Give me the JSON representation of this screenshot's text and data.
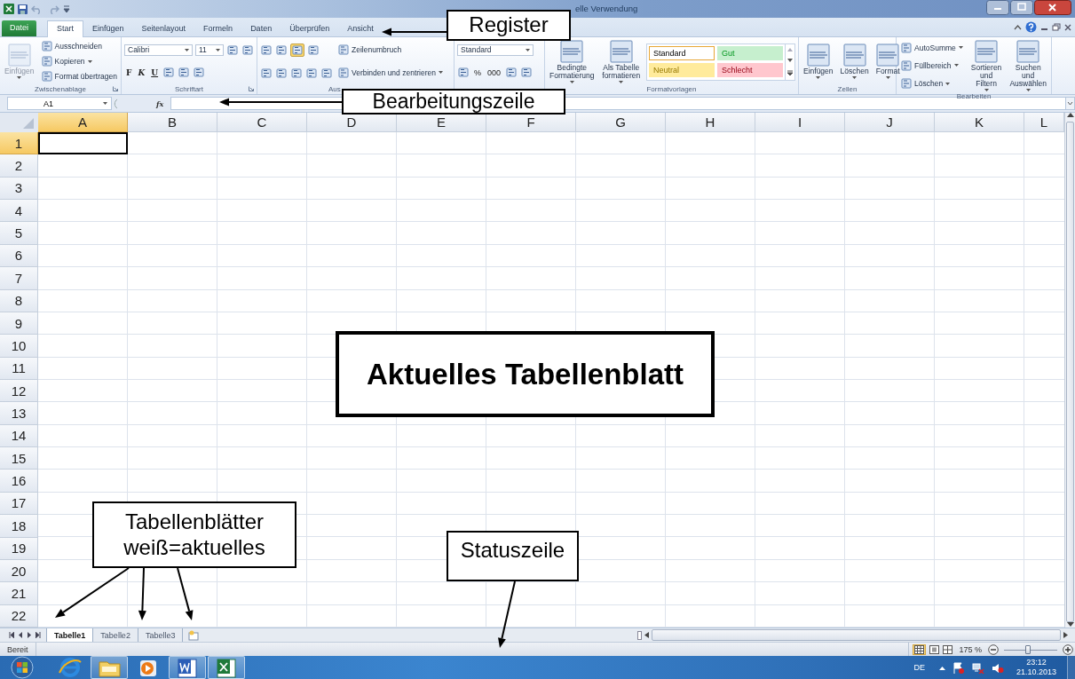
{
  "window": {
    "title": "elle Verwendung"
  },
  "tabs": [
    {
      "label": "Datei",
      "kind": "file",
      "selected": false
    },
    {
      "label": "Start",
      "kind": "tab",
      "selected": true
    },
    {
      "label": "Einfügen",
      "kind": "tab",
      "selected": false
    },
    {
      "label": "Seitenlayout",
      "kind": "tab",
      "selected": false
    },
    {
      "label": "Formeln",
      "kind": "tab",
      "selected": false
    },
    {
      "label": "Daten",
      "kind": "tab",
      "selected": false
    },
    {
      "label": "Überprüfen",
      "kind": "tab",
      "selected": false
    },
    {
      "label": "Ansicht",
      "kind": "tab",
      "selected": false
    }
  ],
  "ribbon": {
    "groups": [
      {
        "label": "Zwischenablage",
        "launcher": true,
        "columns": [
          [
            {
              "kind": "large",
              "label": "Einfügen",
              "dropdown": true,
              "disabled": true
            }
          ],
          [
            {
              "kind": "small",
              "label": "Ausschneiden"
            },
            {
              "kind": "small",
              "label": "Kopieren",
              "dropdown": true
            },
            {
              "kind": "small",
              "label": "Format übertragen"
            }
          ]
        ]
      },
      {
        "label": "Schriftart",
        "launcher": true,
        "columns": [
          [
            {
              "kind": "row",
              "items": [
                {
                  "kind": "combo",
                  "value": "Calibri"
                },
                {
                  "kind": "combo",
                  "value": "11"
                },
                {
                  "kind": "icon",
                  "selected": false
                },
                {
                  "kind": "icon",
                  "selected": false
                }
              ]
            },
            {
              "kind": "row",
              "items": [
                {
                  "kind": "bold",
                  "label": "F"
                },
                {
                  "kind": "italic",
                  "label": "K"
                },
                {
                  "kind": "underline",
                  "label": "U"
                },
                {
                  "kind": "icon",
                  "selected": false
                },
                {
                  "kind": "icon",
                  "selected": false
                },
                {
                  "kind": "icon",
                  "selected": false
                }
              ]
            }
          ]
        ]
      },
      {
        "label": "Aus",
        "columns": [
          [
            {
              "kind": "row",
              "items": [
                {
                  "kind": "icon",
                  "selected": false
                },
                {
                  "kind": "icon",
                  "selected": false
                },
                {
                  "kind": "icon",
                  "selected": true
                },
                {
                  "kind": "icon",
                  "selected": false
                }
              ]
            },
            {
              "kind": "row",
              "items": [
                {
                  "kind": "icon",
                  "selected": false
                },
                {
                  "kind": "icon",
                  "selected": false
                },
                {
                  "kind": "icon",
                  "selected": false
                },
                {
                  "kind": "icon",
                  "selected": false
                },
                {
                  "kind": "icon",
                  "selected": false
                }
              ]
            }
          ],
          [
            {
              "kind": "small",
              "label": "Zeilenumbruch"
            },
            {
              "kind": "small",
              "label": "Verbinden und zentrieren",
              "dropdown": true
            }
          ]
        ]
      },
      {
        "columns": [
          [
            {
              "kind": "combo",
              "value": "Standard"
            },
            {
              "kind": "row",
              "items": [
                {
                  "kind": "icon",
                  "selected": false
                },
                {
                  "kind": "percent",
                  "label": "%"
                },
                {
                  "kind": "thousands",
                  "label": "000"
                },
                {
                  "kind": "icon",
                  "selected": false
                },
                {
                  "kind": "icon",
                  "selected": false
                }
              ]
            }
          ]
        ]
      },
      {
        "label": "Formatvorlagen",
        "columns": [
          [
            {
              "kind": "large",
              "label": "Bedingte Formatierung",
              "dropdown": true,
              "disabled": false
            }
          ],
          [
            {
              "kind": "large",
              "label": "Als Tabelle formatieren",
              "dropdown": true,
              "disabled": false
            }
          ],
          [
            {
              "kind": "gallery",
              "styles": [
                {
                  "label": "Standard",
                  "color": "#ffffff",
                  "selected": true
                },
                {
                  "label": "Gut",
                  "color": "#c6efce",
                  "selected": false
                },
                {
                  "label": "Neutral",
                  "color": "#ffeb9c",
                  "selected": false
                },
                {
                  "label": "Schlecht",
                  "color": "#ffc7ce",
                  "selected": false
                }
              ]
            }
          ]
        ]
      },
      {
        "label": "Zellen",
        "columns": [
          [
            {
              "kind": "large",
              "label": "Einfügen",
              "dropdown": true,
              "disabled": false
            }
          ],
          [
            {
              "kind": "large",
              "label": "Löschen",
              "dropdown": true,
              "disabled": false
            }
          ],
          [
            {
              "kind": "large",
              "label": "Format",
              "dropdown": true,
              "disabled": false
            }
          ]
        ]
      },
      {
        "label": "Bearbeiten",
        "columns": [
          [
            {
              "kind": "small",
              "label": "AutoSumme",
              "dropdown": true
            },
            {
              "kind": "small",
              "label": "Füllbereich",
              "dropdown": true
            },
            {
              "kind": "small",
              "label": "Löschen",
              "dropdown": true
            }
          ],
          [
            {
              "kind": "large",
              "label": "Sortieren und Filtern",
              "dropdown": true,
              "disabled": false
            }
          ],
          [
            {
              "kind": "large",
              "label": "Suchen und Auswählen",
              "dropdown": true,
              "disabled": false
            }
          ]
        ]
      }
    ]
  },
  "formula_bar": {
    "name_box": "A1",
    "function_label": "fx"
  },
  "sheet": {
    "columns": [
      {
        "label": "A",
        "selected": true
      },
      {
        "label": "B",
        "selected": false
      },
      {
        "label": "C",
        "selected": false
      },
      {
        "label": "D",
        "selected": false
      },
      {
        "label": "E",
        "selected": false
      },
      {
        "label": "F",
        "selected": false
      },
      {
        "label": "G",
        "selected": false
      },
      {
        "label": "H",
        "selected": false
      },
      {
        "label": "I",
        "selected": false
      },
      {
        "label": "J",
        "selected": false
      },
      {
        "label": "K",
        "selected": false
      },
      {
        "label": "L",
        "selected": false
      }
    ],
    "rows": [
      {
        "label": "1",
        "selected": true
      },
      {
        "label": "2",
        "selected": false
      },
      {
        "label": "3",
        "selected": false
      },
      {
        "label": "4",
        "selected": false
      },
      {
        "label": "5",
        "selected": false
      },
      {
        "label": "6",
        "selected": false
      },
      {
        "label": "7",
        "selected": false
      },
      {
        "label": "8",
        "selected": false
      },
      {
        "label": "9",
        "selected": false
      },
      {
        "label": "10",
        "selected": false
      },
      {
        "label": "11",
        "selected": false
      },
      {
        "label": "12",
        "selected": false
      },
      {
        "label": "13",
        "selected": false
      },
      {
        "label": "14",
        "selected": false
      },
      {
        "label": "15",
        "selected": false
      },
      {
        "label": "16",
        "selected": false
      },
      {
        "label": "17",
        "selected": false
      },
      {
        "label": "18",
        "selected": false
      },
      {
        "label": "19",
        "selected": false
      },
      {
        "label": "20",
        "selected": false
      },
      {
        "label": "21",
        "selected": false
      },
      {
        "label": "22",
        "selected": false
      }
    ]
  },
  "sheet_tabs": [
    {
      "label": "Tabelle1",
      "selected": true
    },
    {
      "label": "Tabelle2",
      "selected": false
    },
    {
      "label": "Tabelle3",
      "selected": false
    }
  ],
  "status_bar": {
    "status": "Bereit",
    "zoom": "175 %",
    "zoom_slider": {
      "level": 0.45
    }
  },
  "taskbar": {
    "apps": [
      {
        "kind": "browser",
        "running": false
      },
      {
        "kind": "folder",
        "running": true
      },
      {
        "kind": "media",
        "running": false
      },
      {
        "kind": "word",
        "running": true
      },
      {
        "kind": "excel",
        "running": true
      }
    ],
    "language": "DE",
    "time": "23:12",
    "date": "21.10.2013"
  },
  "callouts": [
    {
      "text": "Register"
    },
    {
      "text": "Bearbeitungszeile"
    },
    {
      "text": "Aktuelles Tabellenblatt"
    },
    {
      "text": "Tabellenblätter weiß=aktuelles"
    },
    {
      "text": "Statuszeile"
    }
  ]
}
